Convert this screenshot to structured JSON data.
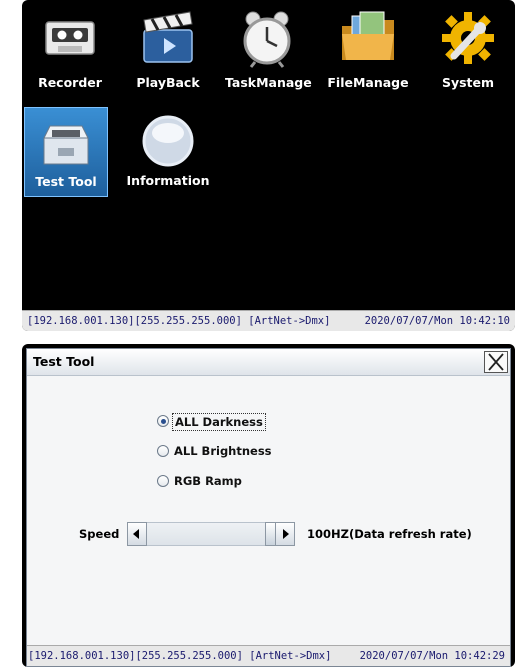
{
  "menu": {
    "items": [
      {
        "label": "Recorder",
        "icon": "cassette-icon"
      },
      {
        "label": "PlayBack",
        "icon": "clapperboard-icon"
      },
      {
        "label": "TaskManage",
        "icon": "alarm-clock-icon"
      },
      {
        "label": "FileManage",
        "icon": "folder-icon"
      },
      {
        "label": "System",
        "icon": "gear-wrench-icon"
      },
      {
        "label": "Test Tool",
        "icon": "toolbox-icon",
        "selected": true
      },
      {
        "label": "Information",
        "icon": "info-orb-icon"
      }
    ]
  },
  "status1": {
    "network": "[192.168.001.130][255.255.255.000] [ArtNet->Dmx]",
    "datetime": "2020/07/07/Mon 10:42:10"
  },
  "dialog": {
    "title": "Test Tool",
    "options": [
      {
        "label": "ALL Darkness",
        "checked": true
      },
      {
        "label": "ALL Brightness",
        "checked": false
      },
      {
        "label": "RGB Ramp",
        "checked": false
      }
    ],
    "speed_label": "Speed",
    "speed_value_text": "100HZ(Data refresh rate)",
    "speed_level": 1.0
  },
  "status2": {
    "network": "[192.168.001.130][255.255.255.000] [ArtNet->Dmx]",
    "datetime": "2020/07/07/Mon 10:42:29"
  },
  "colors": {
    "selected_bg": "#2a79c2",
    "status_text": "#1a1a6e"
  }
}
